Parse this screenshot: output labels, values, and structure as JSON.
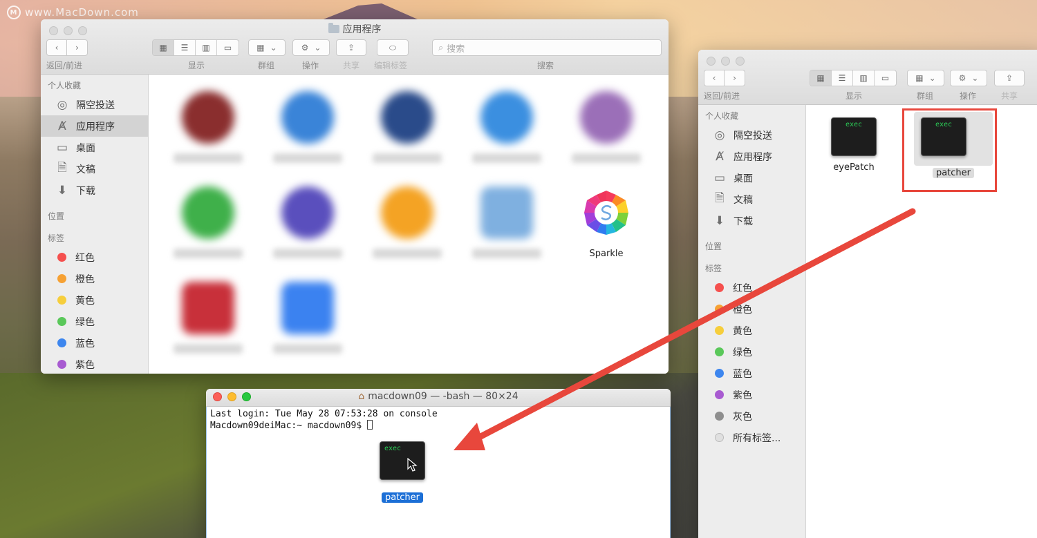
{
  "watermark": {
    "text": "www.MacDown.com",
    "logo": "M"
  },
  "finder_left": {
    "title": "应用程序",
    "toolbar": {
      "nav_label": "返回/前进",
      "view_label": "显示",
      "group_label": "群组",
      "action_label": "操作",
      "share_label": "共享",
      "tags_label": "编辑标签",
      "search_label": "搜索",
      "search_placeholder": "搜索"
    },
    "sidebar": {
      "favorites_header": "个人收藏",
      "favorites": [
        {
          "label": "隔空投送",
          "icon": "airdrop-icon"
        },
        {
          "label": "应用程序",
          "icon": "applications-icon"
        },
        {
          "label": "桌面",
          "icon": "desktop-icon"
        },
        {
          "label": "文稿",
          "icon": "documents-icon"
        },
        {
          "label": "下载",
          "icon": "downloads-icon"
        }
      ],
      "locations_header": "位置",
      "tags_header": "标签",
      "tags": [
        {
          "label": "红色",
          "color": "#f5504e"
        },
        {
          "label": "橙色",
          "color": "#f6a133"
        },
        {
          "label": "黄色",
          "color": "#f6ce3c"
        },
        {
          "label": "绿色",
          "color": "#5ac85a"
        },
        {
          "label": "蓝色",
          "color": "#3d86ee"
        },
        {
          "label": "紫色",
          "color": "#a85bd1"
        }
      ]
    },
    "apps": [
      {
        "color": "#8a2e2e"
      },
      {
        "color": "#3a84d8"
      },
      {
        "color": "#2a4b8a"
      },
      {
        "color": "#3b8fe0"
      },
      {
        "color": "#9b6fb8"
      },
      {
        "color": "#3fb04a"
      },
      {
        "color": "#5a4fbd"
      },
      {
        "color": "#f4a324"
      },
      {
        "color": "#7fb0e0"
      },
      {
        "color": "#c8303a"
      },
      {
        "color": "#3b82f0"
      }
    ],
    "sparkle_label": "Sparkle"
  },
  "finder_right": {
    "toolbar": {
      "nav_label": "返回/前进",
      "view_label": "显示",
      "group_label": "群组",
      "action_label": "操作",
      "share_label": "共享"
    },
    "sidebar": {
      "favorites_header": "个人收藏",
      "favorites": [
        {
          "label": "隔空投送",
          "icon": "airdrop-icon"
        },
        {
          "label": "应用程序",
          "icon": "applications-icon"
        },
        {
          "label": "桌面",
          "icon": "desktop-icon"
        },
        {
          "label": "文稿",
          "icon": "documents-icon"
        },
        {
          "label": "下载",
          "icon": "downloads-icon"
        }
      ],
      "locations_header": "位置",
      "tags_header": "标签",
      "tags": [
        {
          "label": "红色",
          "color": "#f5504e"
        },
        {
          "label": "橙色",
          "color": "#f6a133"
        },
        {
          "label": "黄色",
          "color": "#f6ce3c"
        },
        {
          "label": "绿色",
          "color": "#5ac85a"
        },
        {
          "label": "蓝色",
          "color": "#3d86ee"
        },
        {
          "label": "紫色",
          "color": "#a85bd1"
        },
        {
          "label": "灰色",
          "color": "#8e8e8e"
        },
        {
          "label": "所有标签...",
          "color": "#e0e0e0"
        }
      ]
    },
    "files": [
      {
        "name": "eyePatch",
        "kind": "exec"
      },
      {
        "name": "patcher",
        "kind": "exec"
      }
    ]
  },
  "terminal": {
    "title": "macdown09 — -bash — 80×24",
    "line1": "Last login: Tue May 28 07:53:28 on console",
    "prompt": "Macdown09deiMac:~ macdown09$ ",
    "dragged_file": "patcher",
    "exec_text": "exec"
  },
  "annotation": {
    "arrow_color": "#e8473c",
    "highlight_color": "#e8473c"
  }
}
